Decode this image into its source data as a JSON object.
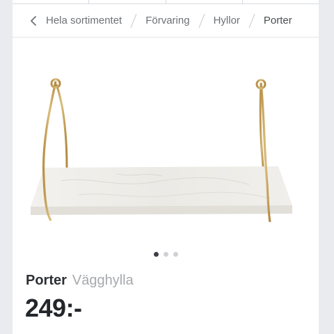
{
  "breadcrumb": {
    "items": [
      {
        "label": "Hela sortimentet"
      },
      {
        "label": "Förvaring"
      },
      {
        "label": "Hyllor"
      },
      {
        "label": "Porter"
      }
    ],
    "back_icon": "chevron-left-icon",
    "separator_icon": "slash-separator-icon"
  },
  "gallery": {
    "image_alt": "Porter Vägghylla",
    "image_count": 3,
    "active_index": 0
  },
  "product": {
    "name": "Porter",
    "type": "Vägghylla",
    "price": "249:-"
  },
  "colors": {
    "brass": "#c9a25a",
    "marble": "#f2f0ec",
    "price_text": "#23262a"
  }
}
